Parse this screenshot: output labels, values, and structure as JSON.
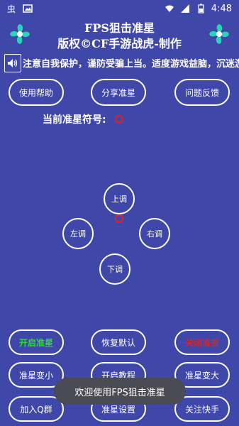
{
  "status_bar": {
    "time": "4:48",
    "left_icons": [
      "app-notification-icon",
      "image-icon"
    ],
    "right_icons": [
      "wifi-icon",
      "signal-icon",
      "battery-icon"
    ]
  },
  "header": {
    "title_line1": "FPS狙击准星",
    "title_line2": "版权©CF手游战虎-制作"
  },
  "marquee": {
    "text": "注意自我保护，谨防受骗上当。适度游戏益脑，沉迷游戏伤身。"
  },
  "top_buttons": {
    "help": "使用帮助",
    "share": "分享准星",
    "feedback": "问题反馈"
  },
  "crosshair": {
    "label": "当前准星符号:",
    "color": "#e02020"
  },
  "direction_pad": {
    "up": "上调",
    "left": "左调",
    "right": "右调",
    "down": "下调"
  },
  "bottom_buttons": {
    "enable": "开启准星",
    "enable_color": "#25e025",
    "reset": "恢复默认",
    "disable": "关闭准星",
    "disable_color": "#e02020",
    "shrink": "准星变小",
    "tutorial": "开启教程",
    "enlarge": "准星变大",
    "join_qq": "加入Q群",
    "settings": "准星设置",
    "follow": "关注快手"
  },
  "toast": {
    "text": "欢迎使用FPS狙击准星"
  }
}
